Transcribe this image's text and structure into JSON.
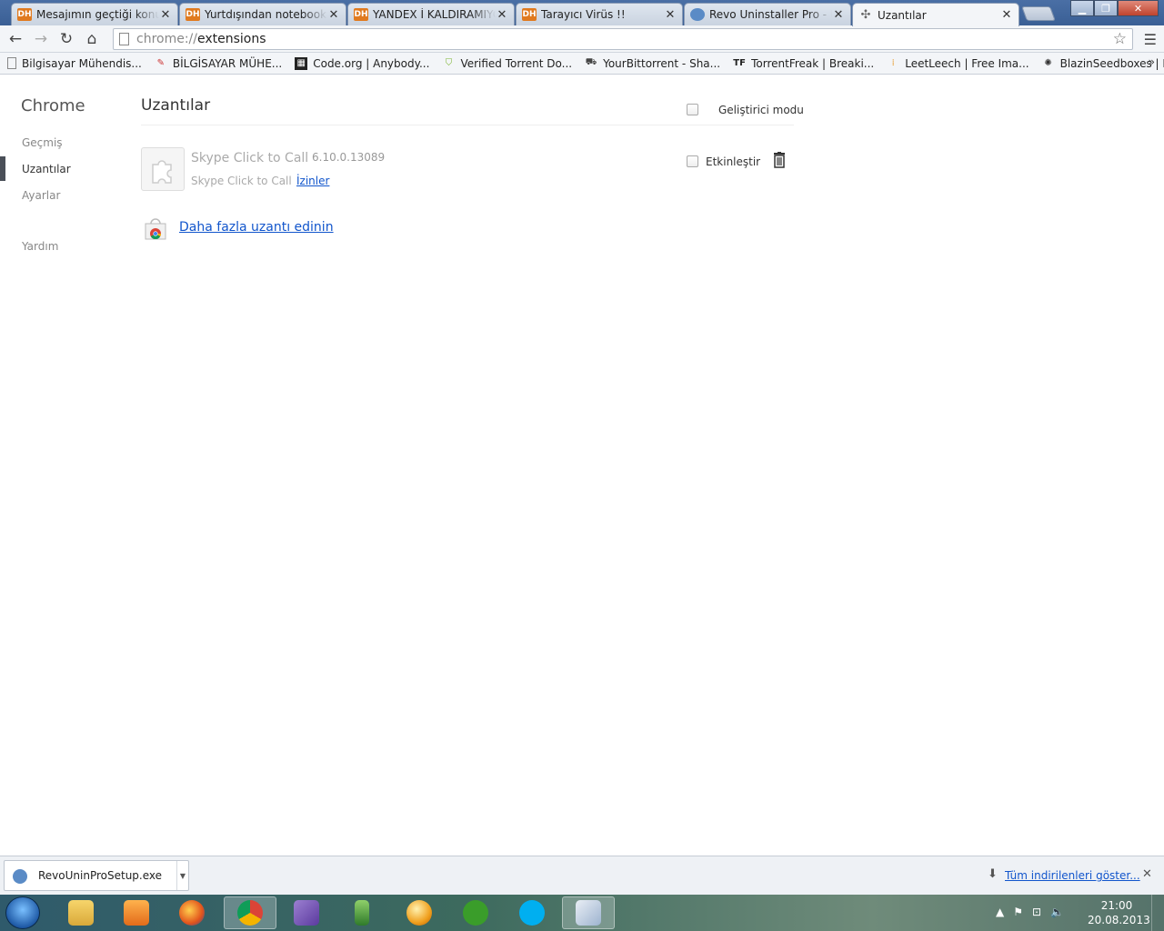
{
  "tabs": [
    {
      "title": "Mesajımın geçtiği konula",
      "favicon": "DH"
    },
    {
      "title": "Yurtdışından notebook a",
      "favicon": "DH"
    },
    {
      "title": "YANDEX İ KALDIRAMIYO",
      "favicon": "DH"
    },
    {
      "title": "Tarayıcı Virüs !!",
      "favicon": "DH"
    },
    {
      "title": "Revo Uninstaller Pro - Un",
      "favicon": "revo-icon"
    },
    {
      "title": "Uzantılar",
      "favicon": "puzzle-icon"
    }
  ],
  "address": {
    "scheme": "chrome://",
    "path": "extensions"
  },
  "bookmarks": [
    {
      "label": "Bilgisayar Mühendis...",
      "icon": "page-icon"
    },
    {
      "label": "BİLGİSAYAR MÜHE...",
      "icon": "site-icon"
    },
    {
      "label": "Code.org | Anybody...",
      "icon": "codeorg-icon"
    },
    {
      "label": "Verified Torrent Do...",
      "icon": "shield-icon"
    },
    {
      "label": "YourBittorrent - Sha...",
      "icon": "ybt-icon"
    },
    {
      "label": "TorrentFreak | Breaki...",
      "icon": "tf-icon"
    },
    {
      "label": "LeetLeech | Free Ima...",
      "icon": "leetleech-icon"
    },
    {
      "label": "BlazinSeedboxes | H...",
      "icon": "blazin-icon"
    }
  ],
  "bookmarks_more": "»",
  "sidebar": {
    "title": "Chrome",
    "items": [
      {
        "label": "Geçmiş"
      },
      {
        "label": "Uzantılar"
      },
      {
        "label": "Ayarlar"
      },
      {
        "label": "Yardım"
      }
    ],
    "selected_index": 1
  },
  "main": {
    "title": "Uzantılar",
    "dev_mode_label": "Geliştirici modu",
    "extension": {
      "name": "Skype Click to Call",
      "version": "6.10.0.13089",
      "description": "Skype Click to Call",
      "permissions_link": "İzinler",
      "enable_label": "Etkinleştir"
    },
    "more_extensions_link": "Daha fazla uzantı edinin"
  },
  "downloads": {
    "file": "RevoUninProSetup.exe",
    "show_all": "Tüm indirilenleri göster..."
  },
  "taskbar": {
    "apps": [
      "explorer",
      "media-player",
      "firefox",
      "chrome",
      "visual-studio",
      "phone-tool",
      "jdownloader",
      "utorrent",
      "skype",
      "paint"
    ],
    "active_app": "chrome"
  },
  "clock": {
    "time": "21:00",
    "date": "20.08.2013"
  }
}
